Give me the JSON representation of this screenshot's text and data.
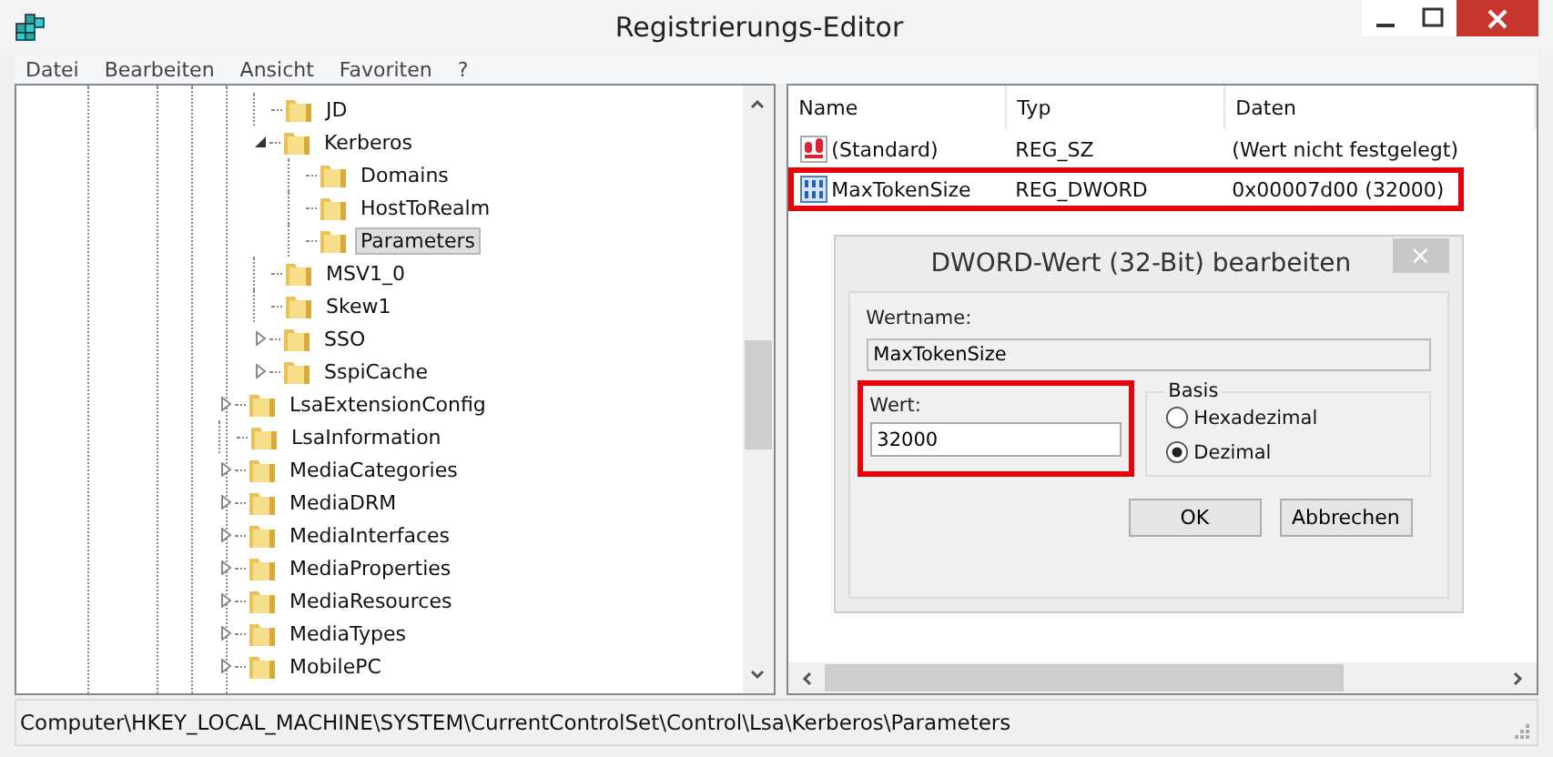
{
  "window": {
    "title": "Registrierungs-Editor"
  },
  "menu": [
    "Datei",
    "Bearbeiten",
    "Ansicht",
    "Favoriten",
    "?"
  ],
  "tree": {
    "items": [
      {
        "children": [
          {
            "label": "JD",
            "selected": false
          },
          {
            "label": "Kerberos",
            "expanded": true,
            "selected": false,
            "children": [
              {
                "label": "Domains",
                "selected": false
              },
              {
                "label": "HostToRealm",
                "selected": false
              },
              {
                "label": "Parameters",
                "selected": true
              }
            ]
          },
          {
            "label": "MSV1_0",
            "selected": false
          },
          {
            "label": "Skew1",
            "selected": false
          },
          {
            "label": "SSO",
            "expanded": false,
            "selected": false
          },
          {
            "label": "SspiCache",
            "expanded": false,
            "selected": false
          }
        ]
      },
      {
        "label": "LsaExtensionConfig",
        "expanded": false,
        "selected": false
      },
      {
        "label": "LsaInformation",
        "selected": false
      },
      {
        "label": "MediaCategories",
        "expanded": false,
        "selected": false
      },
      {
        "label": "MediaDRM",
        "expanded": false,
        "selected": false
      },
      {
        "label": "MediaInterfaces",
        "expanded": false,
        "selected": false
      },
      {
        "label": "MediaProperties",
        "expanded": false,
        "selected": false
      },
      {
        "label": "MediaResources",
        "expanded": false,
        "selected": false
      },
      {
        "label": "MediaTypes",
        "expanded": false,
        "selected": false
      },
      {
        "label": "MobilePC",
        "expanded": false,
        "selected": false
      }
    ]
  },
  "values": {
    "columns": [
      "Name",
      "Typ",
      "Daten"
    ],
    "rows": [
      {
        "kind": "string",
        "name": "(Standard)",
        "type": "REG_SZ",
        "data": "(Wert nicht festgelegt)",
        "highlighted": false
      },
      {
        "kind": "binary",
        "name": "MaxTokenSize",
        "type": "REG_DWORD",
        "data": "0x00007d00 (32000)",
        "highlighted": true
      }
    ]
  },
  "dialog": {
    "title": "DWORD-Wert (32-Bit) bearbeiten",
    "close": "×",
    "name_label": "Wertname:",
    "name_value": "MaxTokenSize",
    "value_label": "Wert:",
    "value": "32000",
    "value_highlighted": true,
    "base_label": "Basis",
    "bases": [
      {
        "label": "Hexadezimal",
        "selected": false
      },
      {
        "label": "Dezimal",
        "selected": true
      }
    ],
    "buttons": [
      "OK",
      "Abbrechen"
    ]
  },
  "status_bar": "Computer\\HKEY_LOCAL_MACHINE\\SYSTEM\\CurrentControlSet\\Control\\Lsa\\Kerberos\\Parameters"
}
